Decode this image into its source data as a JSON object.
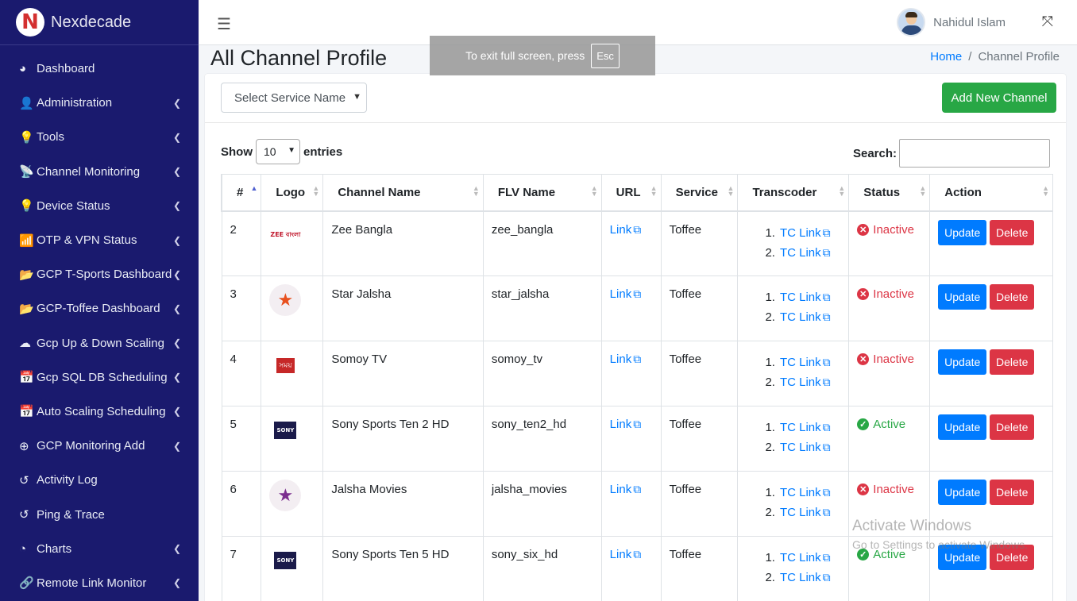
{
  "brand": {
    "name": "Nexdecade",
    "logo_letter": "N"
  },
  "sidebar": {
    "items": [
      {
        "label": "Dashboard",
        "icon": "gauge-icon",
        "glyph": "◕",
        "expandable": false
      },
      {
        "label": "Administration",
        "icon": "user-cog-icon",
        "glyph": "👤",
        "expandable": true
      },
      {
        "label": "Tools",
        "icon": "lightbulb-icon",
        "glyph": "💡",
        "expandable": true
      },
      {
        "label": "Channel Monitoring",
        "icon": "satellite-dish-icon",
        "glyph": "📡",
        "expandable": true
      },
      {
        "label": "Device Status",
        "icon": "lightbulb-icon",
        "glyph": "💡",
        "expandable": true
      },
      {
        "label": "OTP & VPN Status",
        "icon": "broadcast-tower-icon",
        "glyph": "📶",
        "expandable": true
      },
      {
        "label": "GCP T-Sports Dashboard",
        "icon": "folder-open-icon",
        "glyph": "📂",
        "expandable": true
      },
      {
        "label": "GCP-Toffee Dashboard",
        "icon": "folder-open-icon",
        "glyph": "📂",
        "expandable": true
      },
      {
        "label": "Gcp Up & Down Scaling",
        "icon": "cloud-icon",
        "glyph": "☁",
        "expandable": true
      },
      {
        "label": "Gcp SQL DB Scheduling",
        "icon": "calendar-icon",
        "glyph": "📅",
        "expandable": true
      },
      {
        "label": "Auto Scaling Scheduling",
        "icon": "calendar-icon",
        "glyph": "📅",
        "expandable": true
      },
      {
        "label": "GCP Monitoring Add",
        "icon": "plus-circle-icon",
        "glyph": "⊕",
        "expandable": true
      },
      {
        "label": "Activity Log",
        "icon": "history-icon",
        "glyph": "↺",
        "expandable": false
      },
      {
        "label": "Ping & Trace",
        "icon": "history-icon",
        "glyph": "↺",
        "expandable": false
      },
      {
        "label": "Charts",
        "icon": "pie-chart-icon",
        "glyph": "◔",
        "expandable": true
      },
      {
        "label": "Remote Link Monitor",
        "icon": "link-icon",
        "glyph": "🔗",
        "expandable": true
      }
    ]
  },
  "topbar": {
    "username": "Nahidul Islam"
  },
  "toast": {
    "text": "To exit full screen, press",
    "key": "Esc"
  },
  "page": {
    "title": "All Channel Profile",
    "breadcrumb": {
      "home": "Home",
      "separator": "/",
      "current": "Channel Profile"
    }
  },
  "card": {
    "service_select": "Select Service Name",
    "add_button": "Add New Channel",
    "show_label": "Show",
    "entries_value": "10",
    "entries_label": "entries",
    "search_label": "Search:",
    "search_value": ""
  },
  "table": {
    "columns": [
      "#",
      "Logo",
      "Channel Name",
      "FLV Name",
      "URL",
      "Service",
      "Transcoder",
      "Status",
      "Action"
    ],
    "rows": [
      {
        "num": "2",
        "logo": "zee-bangla-logo",
        "logo_text": "ZEE বাংলা",
        "channel": "Zee Bangla",
        "flv": "zee_bangla",
        "url": "Link",
        "service": "Toffee",
        "tc": [
          "TC Link",
          "TC Link"
        ],
        "status": "Inactive",
        "status_kind": "inactive"
      },
      {
        "num": "3",
        "logo": "star-jalsha-logo",
        "logo_text": "★",
        "channel": "Star Jalsha",
        "flv": "star_jalsha",
        "url": "Link",
        "service": "Toffee",
        "tc": [
          "TC Link",
          "TC Link"
        ],
        "status": "Inactive",
        "status_kind": "inactive"
      },
      {
        "num": "4",
        "logo": "somoy-tv-logo",
        "logo_text": "সময়",
        "channel": "Somoy TV",
        "flv": "somoy_tv",
        "url": "Link",
        "service": "Toffee",
        "tc": [
          "TC Link",
          "TC Link"
        ],
        "status": "Inactive",
        "status_kind": "inactive"
      },
      {
        "num": "5",
        "logo": "sony-ten2-logo",
        "logo_text": "SONY",
        "channel": "Sony Sports Ten 2 HD",
        "flv": "sony_ten2_hd",
        "url": "Link",
        "service": "Toffee",
        "tc": [
          "TC Link",
          "TC Link"
        ],
        "status": "Active",
        "status_kind": "active"
      },
      {
        "num": "6",
        "logo": "jalsha-movies-logo",
        "logo_text": "★",
        "channel": "Jalsha Movies",
        "flv": "jalsha_movies",
        "url": "Link",
        "service": "Toffee",
        "tc": [
          "TC Link",
          "TC Link"
        ],
        "status": "Inactive",
        "status_kind": "inactive"
      },
      {
        "num": "7",
        "logo": "sony-ten5-logo",
        "logo_text": "SONY",
        "channel": "Sony Sports Ten 5 HD",
        "flv": "sony_six_hd",
        "url": "Link",
        "service": "Toffee",
        "tc": [
          "TC Link",
          "TC Link"
        ],
        "status": "Active",
        "status_kind": "active"
      }
    ],
    "update_label": "Update",
    "delete_label": "Delete"
  },
  "watermark": {
    "line1": "Activate Windows",
    "line2": "Go to Settings to activate Windows."
  },
  "colors": {
    "sidebar": "#1a1a6e",
    "primary": "#007bff",
    "success": "#28a745",
    "danger": "#dc3545"
  }
}
